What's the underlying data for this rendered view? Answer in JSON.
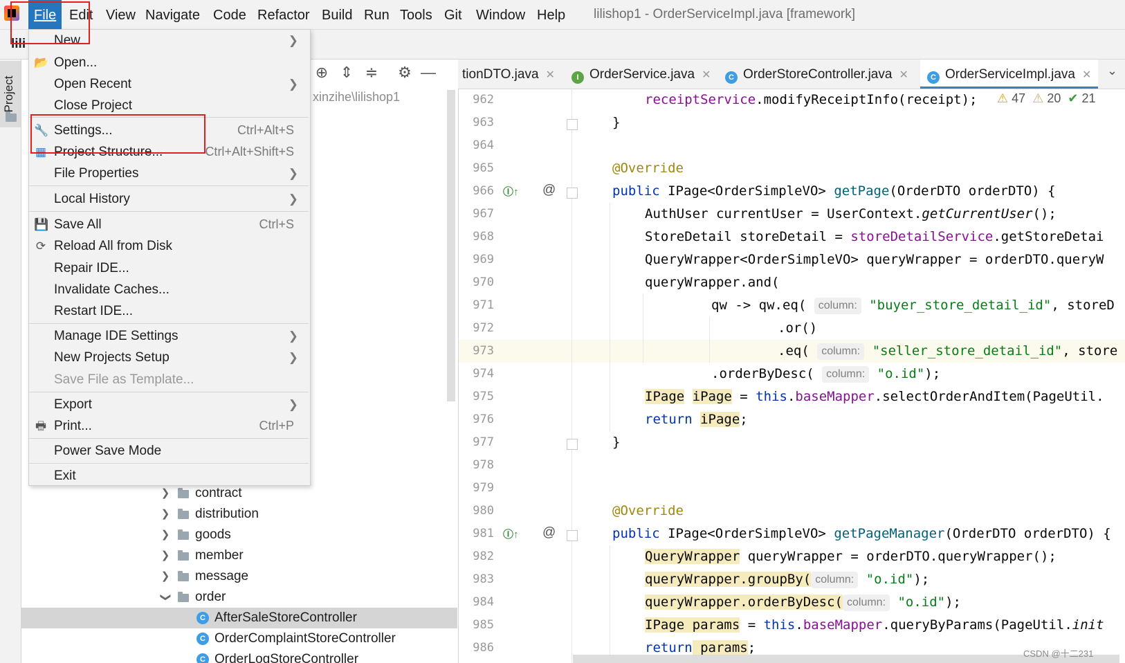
{
  "menubar": {
    "items": [
      "File",
      "Edit",
      "View",
      "Navigate",
      "Code",
      "Refactor",
      "Build",
      "Run",
      "Tools",
      "Git",
      "Window",
      "Help"
    ],
    "window_title": "lilishop1 - OrderServiceImpl.java [framework]"
  },
  "file_menu": {
    "items": [
      {
        "label": "New",
        "shortcut": "",
        "submenu": true
      },
      {
        "label": "Open...",
        "shortcut": "",
        "icon": "folder-open-icon"
      },
      {
        "label": "Open Recent",
        "shortcut": "",
        "submenu": true
      },
      {
        "label": "Close Project",
        "shortcut": ""
      },
      {
        "label": "Settings...",
        "shortcut": "Ctrl+Alt+S",
        "icon": "wrench-icon"
      },
      {
        "label": "Project Structure...",
        "shortcut": "Ctrl+Alt+Shift+S",
        "icon": "project-structure-icon"
      },
      {
        "label": "File Properties",
        "shortcut": "",
        "submenu": true
      },
      {
        "label": "Local History",
        "shortcut": "",
        "submenu": true
      },
      {
        "label": "Save All",
        "shortcut": "Ctrl+S",
        "icon": "save-icon"
      },
      {
        "label": "Reload All from Disk",
        "shortcut": "",
        "icon": "reload-icon"
      },
      {
        "label": "Repair IDE...",
        "shortcut": ""
      },
      {
        "label": "Invalidate Caches...",
        "shortcut": ""
      },
      {
        "label": "Restart IDE...",
        "shortcut": ""
      },
      {
        "label": "Manage IDE Settings",
        "shortcut": "",
        "submenu": true
      },
      {
        "label": "New Projects Setup",
        "shortcut": "",
        "submenu": true
      },
      {
        "label": "Save File as Template...",
        "shortcut": "",
        "disabled": true
      },
      {
        "label": "Export",
        "shortcut": "",
        "submenu": true
      },
      {
        "label": "Print...",
        "shortcut": "Ctrl+P",
        "icon": "printer-icon"
      },
      {
        "label": "Power Save Mode",
        "shortcut": ""
      },
      {
        "label": "Exit",
        "shortcut": ""
      }
    ]
  },
  "left_stripe": {
    "project_tab": "Project"
  },
  "project_panel": {
    "toolbar_label": "lili",
    "path": "xinzihe\\lilishop1",
    "tree": [
      {
        "label": "contract",
        "type": "folder",
        "expanded": false
      },
      {
        "label": "distribution",
        "type": "folder",
        "expanded": false
      },
      {
        "label": "goods",
        "type": "folder",
        "expanded": false
      },
      {
        "label": "member",
        "type": "folder",
        "expanded": false
      },
      {
        "label": "message",
        "type": "folder",
        "expanded": false
      },
      {
        "label": "order",
        "type": "folder",
        "expanded": true
      },
      {
        "label": "AfterSaleStoreController",
        "type": "class",
        "selected": true
      },
      {
        "label": "OrderComplaintStoreController",
        "type": "class"
      },
      {
        "label": "OrderLogStoreController",
        "type": "class"
      }
    ]
  },
  "editor": {
    "tabs": [
      {
        "label": "tionDTO.java",
        "icon": ""
      },
      {
        "label": "OrderService.java",
        "icon": "I"
      },
      {
        "label": "OrderStoreController.java",
        "icon": "C"
      },
      {
        "label": "OrderServiceImpl.java",
        "icon": "C",
        "active": true
      }
    ],
    "inspections": {
      "warnings": "47",
      "weak_warnings": "20",
      "typos": "21"
    },
    "line_numbers": [
      "962",
      "963",
      "964",
      "965",
      "966",
      "967",
      "968",
      "969",
      "970",
      "971",
      "972",
      "973",
      "974",
      "975",
      "976",
      "977",
      "978",
      "979",
      "980",
      "981",
      "982",
      "983",
      "984",
      "985",
      "986"
    ],
    "code": {
      "l962": {
        "a": "receiptService",
        "b": ".modifyReceiptInfo(receipt);"
      },
      "l963": "}",
      "l965": "@Override",
      "l966": {
        "kw": "public",
        "type": "IPage<OrderSimpleVO>",
        "method": "getPage",
        "args": "(OrderDTO orderDTO) {"
      },
      "l967": {
        "a": "AuthUser currentUser = UserContext.",
        "b": "getCurrentUser",
        "c": "();"
      },
      "l968": {
        "a": "StoreDetail storeDetail = ",
        "b": "storeDetailService",
        "c": ".getStoreDetai"
      },
      "l969": "QueryWrapper<OrderSimpleVO> queryWrapper = orderDTO.queryW",
      "l970": "queryWrapper.and(",
      "l971": {
        "a": "qw -> qw.eq(",
        "hint": "column:",
        "str": "\"buyer_store_detail_id\"",
        "rest": ", storeD"
      },
      "l972": ".or()",
      "l973": {
        "a": ".eq(",
        "hint": "column:",
        "str": "\"seller_store_detail_id\"",
        "rest": ", store"
      },
      "l974": {
        "a": ".orderByDesc(",
        "hint": "column:",
        "str": "\"o.id\"",
        "rest": ");"
      },
      "l975": {
        "a": "IPage",
        "b": "iPage",
        "c": " = ",
        "kw": "this",
        "d": ".",
        "fld": "baseMapper",
        "e": ".selectOrderAndItem(PageUtil."
      },
      "l976": {
        "kw": "return",
        "b": "iPage",
        "c": ";"
      },
      "l977": "}",
      "l980": "@Override",
      "l981": {
        "kw": "public",
        "type": "IPage<OrderSimpleVO>",
        "method": "getPageManager",
        "args": "(OrderDTO orderDTO) {"
      },
      "l982": {
        "a": "QueryWrapper",
        "b": " queryWrapper = orderDTO.queryWrapper();"
      },
      "l983": {
        "a": "queryWrapper.groupBy(",
        "hint": "column:",
        "str": "\"o.id\"",
        "rest": ");"
      },
      "l984": {
        "a": "queryWrapper.orderByDesc(",
        "hint": "column:",
        "str": "\"o.id\"",
        "rest": ");"
      },
      "l985": {
        "a": "IPage",
        "b": " params",
        "c": " = ",
        "kw": "this",
        "d": ".",
        "fld": "baseMapper",
        "e": ".queryByParams(PageUtil.",
        "f": "init"
      },
      "l986": {
        "kw": "return",
        "b": " params",
        "c": ";"
      }
    }
  },
  "watermark": "CSDN @十二231",
  "colors": {
    "menu_active": "#2675bf",
    "highlight_box": "#e02020",
    "keyword": "#0033b3",
    "annotation": "#9e880d",
    "string": "#067d17"
  }
}
